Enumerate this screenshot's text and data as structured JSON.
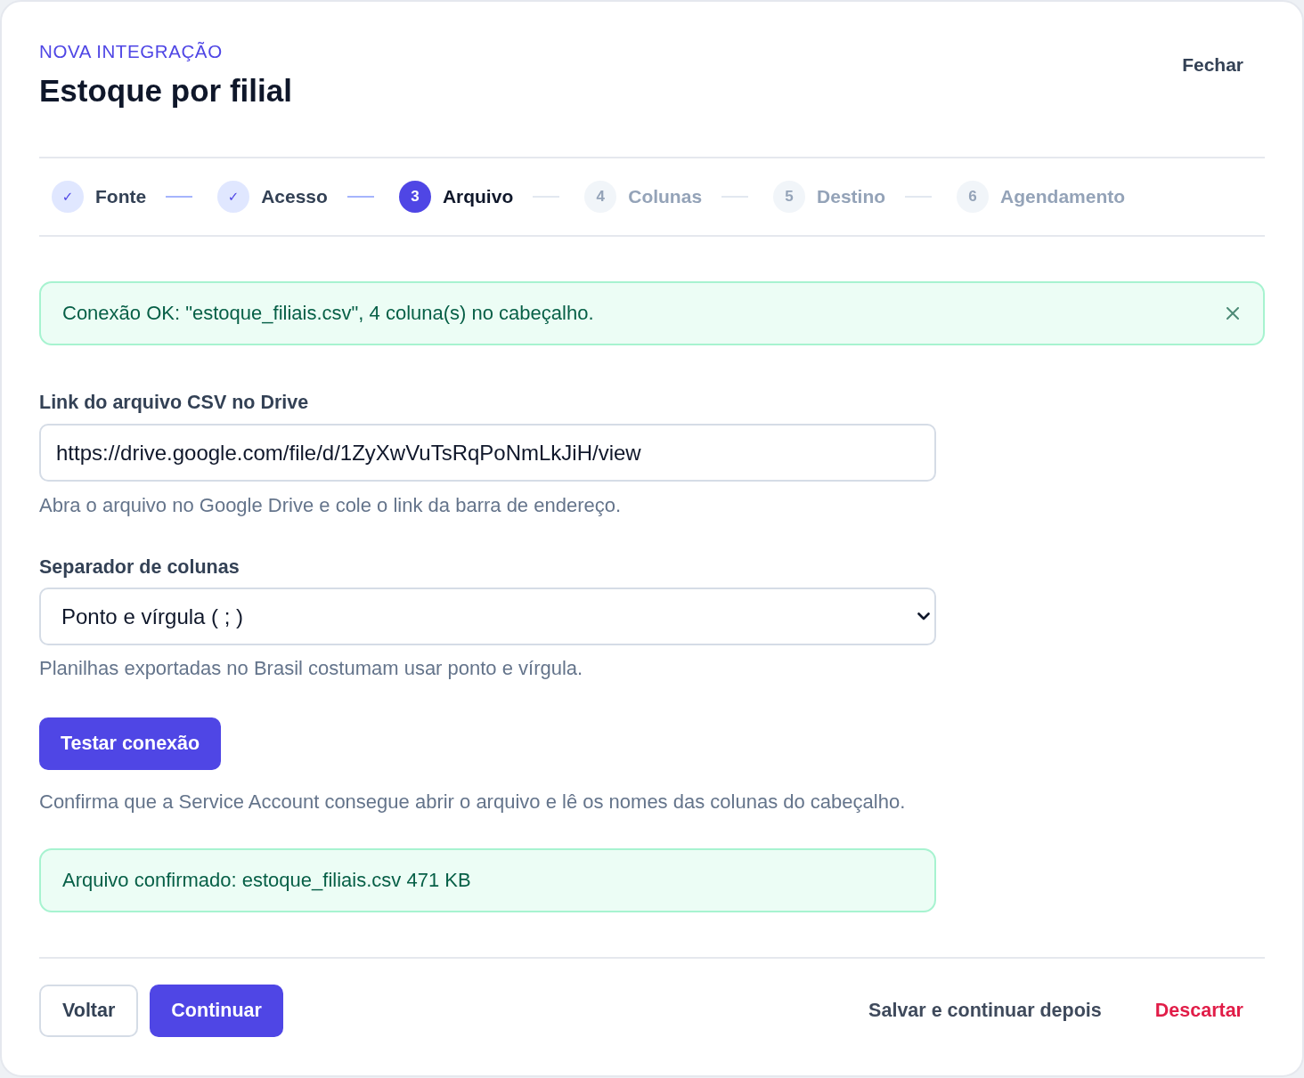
{
  "header": {
    "eyebrow": "NOVA INTEGRAÇÃO",
    "title": "Estoque por filial",
    "close_button": "Fechar"
  },
  "steps": [
    {
      "marker": "✓",
      "label": "Fonte",
      "completed": true,
      "selected": false
    },
    {
      "marker": "✓",
      "label": "Acesso",
      "completed": true,
      "selected": false
    },
    {
      "marker": "3",
      "label": "Arquivo",
      "completed": false,
      "selected": true
    },
    {
      "marker": "4",
      "label": "Colunas",
      "completed": false,
      "selected": false
    },
    {
      "marker": "5",
      "label": "Destino",
      "completed": false,
      "selected": false
    },
    {
      "marker": "6",
      "label": "Agendamento",
      "completed": false,
      "selected": false
    }
  ],
  "banner": {
    "text": "Conexão OK: \"estoque_filiais.csv\", 4 coluna(s) no cabeçalho.",
    "dismissible": true
  },
  "fields": [
    {
      "kind": "text",
      "label": "Link do arquivo CSV no Drive",
      "value": "https://drive.google.com/file/d/1ZyXwVuTsRqPoNmLkJiH/view",
      "hint": "Abra o arquivo no Google Drive e cole o link da barra de endereço."
    },
    {
      "kind": "select",
      "label": "Separador de colunas",
      "value": "Ponto e vírgula ( ; )",
      "hint": "Planilhas exportadas no Brasil costumam usar ponto e vírgula."
    }
  ],
  "test": {
    "button": "Testar conexão",
    "hint": "Confirma que a Service Account consegue abrir o arquivo e lê os nomes das colunas do cabeçalho."
  },
  "result": {
    "text": "Arquivo confirmado: estoque_filiais.csv 471 KB"
  },
  "footer": {
    "left": [
      {
        "label": "Voltar",
        "kind": "secondary"
      },
      {
        "label": "Continuar",
        "kind": "primary"
      }
    ],
    "right": [
      {
        "label": "Salvar e continuar depois",
        "kind": "neutral"
      },
      {
        "label": "Descartar",
        "kind": "danger"
      }
    ]
  }
}
